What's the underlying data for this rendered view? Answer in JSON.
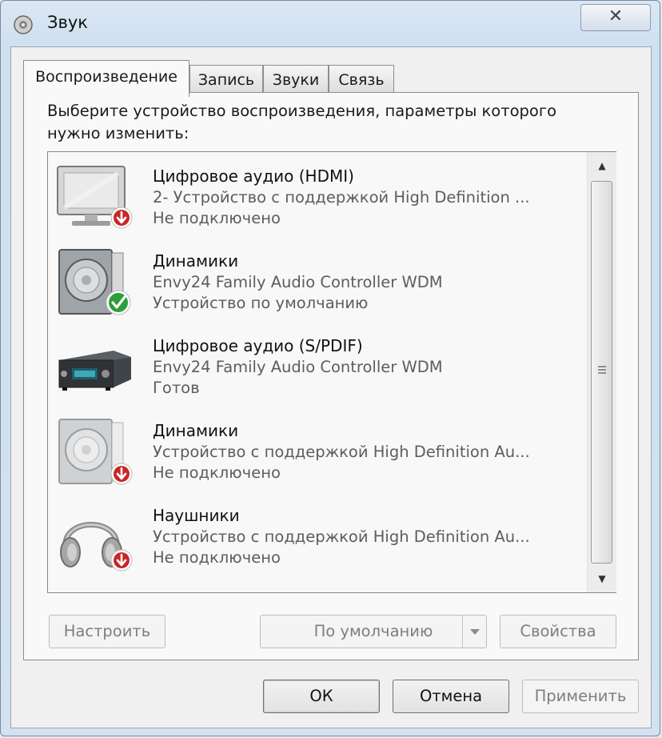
{
  "window": {
    "title": "Звук",
    "close_label": "✕"
  },
  "tabs": [
    {
      "label": "Воспроизведение",
      "active": true
    },
    {
      "label": "Запись",
      "active": false
    },
    {
      "label": "Звуки",
      "active": false
    },
    {
      "label": "Связь",
      "active": false
    }
  ],
  "instruction": "Выберите устройство воспроизведения, параметры которого нужно изменить:",
  "devices": [
    {
      "name": "Цифровое аудио (HDMI)",
      "description": "2- Устройство с поддержкой High Definition ...",
      "status": "Не подключено",
      "icon": "monitor-icon",
      "badge": "disconnected-badge-icon"
    },
    {
      "name": "Динамики",
      "description": "Envy24 Family Audio Controller WDM",
      "status": "Устройство по умолчанию",
      "icon": "speaker-icon",
      "badge": "default-check-icon"
    },
    {
      "name": "Цифровое аудио (S/PDIF)",
      "description": "Envy24 Family Audio Controller WDM",
      "status": "Готов",
      "icon": "receiver-icon",
      "badge": ""
    },
    {
      "name": "Динамики",
      "description": "Устройство с поддержкой High Definition Au...",
      "status": "Не подключено",
      "icon": "speaker-icon",
      "badge": "disconnected-badge-icon"
    },
    {
      "name": "Наушники",
      "description": "Устройство с поддержкой High Definition Au...",
      "status": "Не подключено",
      "icon": "headphones-icon",
      "badge": "disconnected-badge-icon"
    }
  ],
  "buttons": {
    "configure": "Настроить",
    "set_default": "По умолчанию",
    "properties": "Свойства",
    "ok": "ОК",
    "cancel": "Отмена",
    "apply": "Применить"
  },
  "colors": {
    "disconnected_badge": "#c62828",
    "default_check": "#2e9d3a",
    "window_frame": "#cfdff0"
  }
}
